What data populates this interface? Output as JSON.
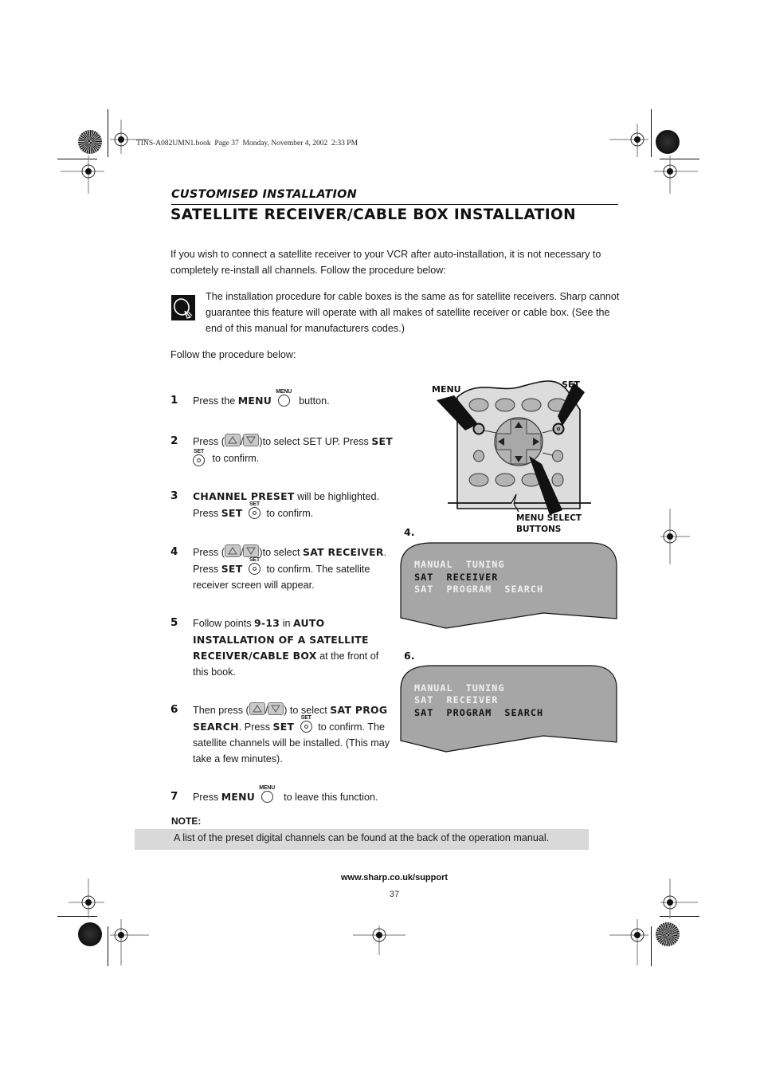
{
  "print_header": "TINS-A082UMN1.book  Page 37  Monday, November 4, 2002  2:33 PM",
  "section_label": "CUSTOMISED INSTALLATION",
  "page_title": "SATELLITE RECEIVER/CABLE BOX INSTALLATION",
  "intro": "If you wish to connect a satellite receiver to your VCR after auto-installation, it is not necessary to completely re-install all channels. Follow the procedure below:",
  "tip": {
    "icon": "satellite-dish-icon",
    "text": "The installation procedure for cable boxes is the same as for satellite receivers. Sharp cannot guarantee this feature will operate with all makes of satellite receiver or cable box. (See the end of this manual for manufacturers codes.)"
  },
  "follow_text": "Follow the procedure below:",
  "button_caps": {
    "menu": "MENU",
    "set": "SET"
  },
  "steps": [
    {
      "num": "1",
      "t1": "Press the ",
      "b1": "MENU",
      "t2": " button."
    },
    {
      "num": "2",
      "t1": "Press (",
      "t2": ")to select SET UP. Press ",
      "b1": "SET",
      "t3": " to confirm."
    },
    {
      "num": "3",
      "b1": "CHANNEL PRESET",
      "t1": " will be highlighted. Press ",
      "b2": "SET",
      "t2": " to confirm."
    },
    {
      "num": "4",
      "t1": "Press (",
      "t2": ")to select ",
      "b1": "SAT RECEIVER",
      "t3": ". Press ",
      "b2": "SET",
      "t4": " to confirm. The satellite receiver screen will appear."
    },
    {
      "num": "5",
      "t1": "Follow points ",
      "b1": "9-13",
      "t2": " in ",
      "b2": "AUTO INSTALLATION OF A SATELLITE RECEIVER/CABLE BOX",
      "t3": " at the front of this book."
    },
    {
      "num": "6",
      "t1": "Then press (",
      "t2": ") to select ",
      "b1": "SAT PROG SEARCH",
      "t3": ". Press ",
      "b2": "SET",
      "t4": " to confirm. The satellite channels will be installed. (This may take a few minutes)."
    },
    {
      "num": "7",
      "t1": "Press ",
      "b1": "MENU",
      "t2": " to leave this function."
    }
  ],
  "remote_diagram": {
    "label_menu": "MENU",
    "label_set": "SET",
    "label_select_1": "MENU SELECT",
    "label_select_2": "BUTTONS"
  },
  "osd_screens": [
    {
      "label": "4.",
      "lines": [
        "MANUAL  TUNING",
        "SAT  RECEIVER",
        "SAT  PROGRAM  SEARCH"
      ],
      "highlighted": 1
    },
    {
      "label": "6.",
      "lines": [
        "MANUAL  TUNING",
        "SAT  RECEIVER",
        "SAT  PROGRAM  SEARCH"
      ],
      "highlighted": 2
    }
  ],
  "note": {
    "label": "NOTE:",
    "text": "A list of the preset digital channels can be found at the back of the operation manual."
  },
  "footer": {
    "url": "www.sharp.co.uk/support",
    "page_number": "37"
  },
  "colors": {
    "osd_bg": "#a6a6a6",
    "note_bg": "#d9d9d9",
    "remote_body": "#dcdcdc",
    "remote_button": "#b4b4b4"
  }
}
